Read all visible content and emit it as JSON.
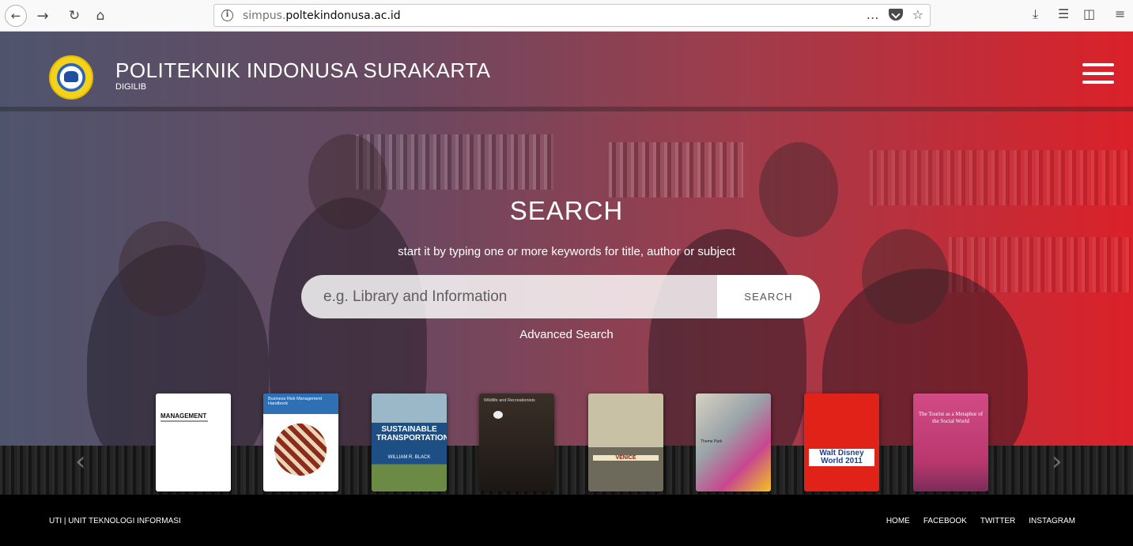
{
  "browser": {
    "url_prefix": "simpus.",
    "url_domain": "poltekindonusa.ac.id",
    "back_icon": "back-arrow-icon",
    "forward_icon": "forward-arrow-icon",
    "reload_icon": "reload-icon",
    "home_icon": "home-icon",
    "page_actions_label": "…",
    "star_label": "☆"
  },
  "header": {
    "title": "POLITEKNIK INDONUSA SURAKARTA",
    "subtitle": "DIGILIB"
  },
  "search": {
    "heading": "SEARCH",
    "hint": "start it by typing one or more keywords for title, author or subject",
    "placeholder": "e.g. Library and Information",
    "button_label": "SEARCH",
    "advanced_label": "Advanced Search"
  },
  "carousel": {
    "prev_label": "‹",
    "next_label": "›",
    "books": [
      {
        "title": "MANAGEMENT"
      },
      {
        "title": "Business Risk Management Handbook"
      },
      {
        "title": "SUSTAINABLE TRANSPORTATION",
        "author": "WILLIAM R. BLACK"
      },
      {
        "title": "Wildlife and Recreationists"
      },
      {
        "title": "VENICE"
      },
      {
        "title": "Theme Park"
      },
      {
        "title": "Walt Disney World 2011"
      },
      {
        "title": "The Tourist as a Metaphor of the Social World"
      }
    ]
  },
  "footer": {
    "left": "UTI | UNIT TEKNOLOGI INFORMASI",
    "links": [
      "HOME",
      "FACEBOOK",
      "TWITTER",
      "INSTAGRAM"
    ]
  },
  "colors": {
    "hero_gradient_start": "#4e546e",
    "hero_gradient_end": "#e21e26",
    "footer": "#000000"
  }
}
